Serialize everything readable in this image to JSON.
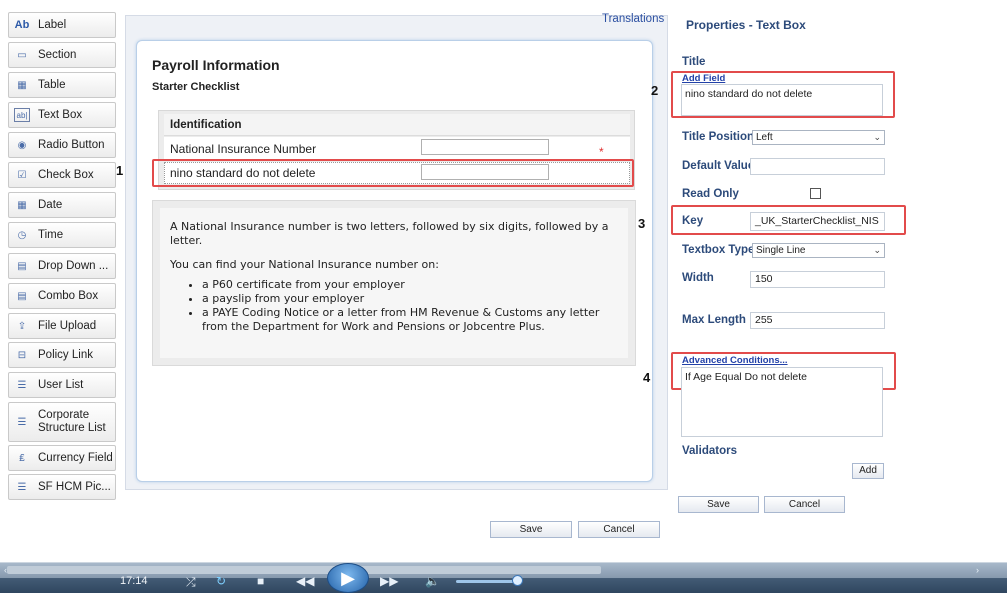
{
  "toolbox": [
    {
      "label": "Label",
      "icon": "label-icon",
      "glyph": "Ab"
    },
    {
      "label": "Section",
      "icon": "section-icon",
      "glyph": "▭"
    },
    {
      "label": "Table",
      "icon": "table-icon",
      "glyph": "▦"
    },
    {
      "label": "Text Box",
      "icon": "text-box-icon",
      "glyph": "ab|"
    },
    {
      "label": "Radio Button",
      "icon": "radio-button-icon",
      "glyph": "◉"
    },
    {
      "label": "Check Box",
      "icon": "check-box-icon",
      "glyph": "☑"
    },
    {
      "label": "Date",
      "icon": "calendar-icon",
      "glyph": "▦"
    },
    {
      "label": "Time",
      "icon": "clock-icon",
      "glyph": "◷"
    },
    {
      "label": "Drop Down ...",
      "icon": "dropdown-icon",
      "glyph": "▤"
    },
    {
      "label": "Combo Box",
      "icon": "combo-box-icon",
      "glyph": "▤"
    },
    {
      "label": "File Upload",
      "icon": "file-upload-icon",
      "glyph": "⇪"
    },
    {
      "label": "Policy Link",
      "icon": "policy-link-icon",
      "glyph": "⊟"
    },
    {
      "label": "User List",
      "icon": "user-list-icon",
      "glyph": "☰"
    },
    {
      "label": "Corporate Structure List",
      "icon": "corporate-structure-icon",
      "glyph": "☰"
    },
    {
      "label": "Currency Field",
      "icon": "currency-icon",
      "glyph": "₤"
    },
    {
      "label": "SF HCM Pic...",
      "icon": "sf-hcm-picker-icon",
      "glyph": "☰"
    }
  ],
  "canvas": {
    "translations_link": "Translations",
    "form_title": "Payroll Information",
    "form_subtitle": "Starter Checklist",
    "section_header": "Identification",
    "row1_label": "National Insurance Number",
    "row1_required": "*",
    "row2_label": "nino standard do not delete",
    "info_para1": "A National Insurance number is two letters, followed by six digits, followed by a letter.",
    "info_para2": "You can find your National Insurance number on:",
    "info_bullets": [
      "a P60 certificate from your employer",
      "a payslip from your employer",
      "a PAYE Coding Notice or a letter from HM Revenue & Customs any letter from the Department for Work and Pensions or Jobcentre Plus."
    ],
    "save_label": "Save",
    "cancel_label": "Cancel"
  },
  "annotations": {
    "n1": "1",
    "n2": "2",
    "n3": "3",
    "n4": "4"
  },
  "properties": {
    "header": "Properties - Text Box",
    "title_label": "Title",
    "add_field_link": "Add Field",
    "title_value": "nino standard do not delete",
    "title_position_label": "Title Position",
    "title_position_value": "Left",
    "default_value_label": "Default Value",
    "read_only_label": "Read Only",
    "key_label": "Key",
    "key_value": "_UK_StarterChecklist_NIS",
    "textbox_type_label": "Textbox Type",
    "textbox_type_value": "Single Line",
    "width_label": "Width",
    "width_value": "150",
    "max_length_label": "Max Length",
    "max_length_value": "255",
    "advanced_link": "Advanced Conditions...",
    "advanced_value": "If Age Equal Do not delete",
    "validators_label": "Validators",
    "add_label": "Add",
    "save_label": "Save",
    "cancel_label": "Cancel"
  },
  "player": {
    "time": "17:14"
  },
  "colors": {
    "accent_red": "#e24b4b",
    "properties_label": "#2c4a7a",
    "link_blue": "#2241a8"
  }
}
